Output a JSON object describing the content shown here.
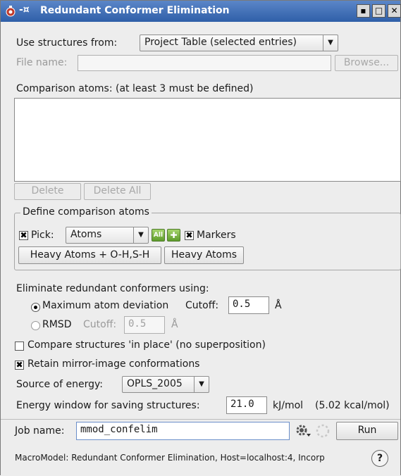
{
  "window": {
    "title": "Redundant Conformer Elimination",
    "pin_symbol": "-¤",
    "controls": [
      "▪",
      "□",
      "✕"
    ]
  },
  "source": {
    "label": "Use structures from:",
    "selected": "Project Table (selected entries)",
    "file_label": "File name:",
    "file_value": "",
    "browse_label": "Browse..."
  },
  "comparison": {
    "label": "Comparison atoms:  (at least 3 must be defined)",
    "items": [],
    "delete_label": "Delete",
    "delete_all_label": "Delete All"
  },
  "define_group": {
    "title": "Define comparison atoms",
    "pick_label": "Pick:",
    "pick_checked": true,
    "pick_selected": "Atoms",
    "all_label": "All",
    "markers_label": "Markers",
    "markers_checked": true,
    "heavy_oh_label": "Heavy Atoms + O-H,S-H",
    "heavy_label": "Heavy Atoms"
  },
  "eliminate": {
    "label": "Eliminate redundant conformers using:",
    "max_dev_label": "Maximum atom deviation",
    "max_dev_selected": true,
    "cutoff_label": "Cutoff:",
    "cutoff_value": "0.5",
    "unit": "Å",
    "rmsd_label": "RMSD",
    "rmsd_cutoff_label": "Cutoff:",
    "rmsd_cutoff_value": "0.5",
    "rmsd_unit": "Å"
  },
  "options": {
    "compare_in_place_label": "Compare structures 'in place' (no superposition)",
    "compare_in_place_checked": false,
    "retain_mirror_label": "Retain mirror-image conformations",
    "retain_mirror_checked": true,
    "energy_source_label": "Source of energy:",
    "energy_source_selected": "OPLS_2005",
    "energy_window_label": "Energy window for saving structures:",
    "energy_window_value": "21.0",
    "energy_unit": "kJ/mol",
    "energy_kcal": "(5.02 kcal/mol)"
  },
  "job": {
    "name_label": "Job name:",
    "name_value": "mmod_confelim",
    "run_label": "Run"
  },
  "status": {
    "text": "MacroModel: Redundant Conformer Elimination, Host=localhost:4, Incorp",
    "help_label": "?"
  }
}
